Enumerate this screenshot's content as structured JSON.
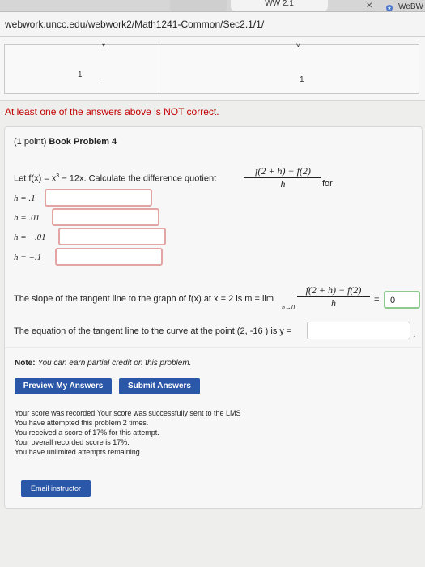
{
  "browser": {
    "tab_left": "...",
    "tab_center": "WW 2.1",
    "tab_right": "WeBW",
    "url": "webwork.uncc.edu/webwork2/Math1241-Common/Sec2.1/1/"
  },
  "grid": {
    "cell_left": "1",
    "cell_right": "1"
  },
  "error_message": "At least one of the answers above is NOT correct.",
  "problem": {
    "title_prefix": "(1 point) ",
    "title": "Book Problem 4",
    "prompt_start": "Let f(x) = x",
    "prompt_exp": "3",
    "prompt_mid": " − 12x. Calculate the difference quotient",
    "prompt_end": "for",
    "dq_num": "f(2 + h) − f(2)",
    "dq_den": "h",
    "h_values": [
      "h = .1",
      "h = .01",
      "h = −.01",
      "h = −.1"
    ],
    "slope_text": "The slope of the tangent line to the graph of f(x) at x = 2 is m = lim",
    "slope_limit_sub": "h→0",
    "slope_num": "f(2 + h) − f(2)",
    "slope_den": "h",
    "slope_equals": "=",
    "slope_value": "0",
    "tangent_text": "The equation of the tangent line to the curve at the point (2, -16 ) is y =",
    "tangent_value": "",
    "note_label": "Note:",
    "note_text": "You can earn partial credit on this problem.",
    "preview_label": "Preview My Answers",
    "submit_label": "Submit Answers",
    "result_lines": [
      "Your score was recorded.Your score was successfully sent to the LMS",
      "You have attempted this problem 2 times.",
      "You received a score of 17% for this attempt.",
      "Your overall recorded score is 17%.",
      "You have unlimited attempts remaining."
    ],
    "email_label": "Email instructor"
  }
}
